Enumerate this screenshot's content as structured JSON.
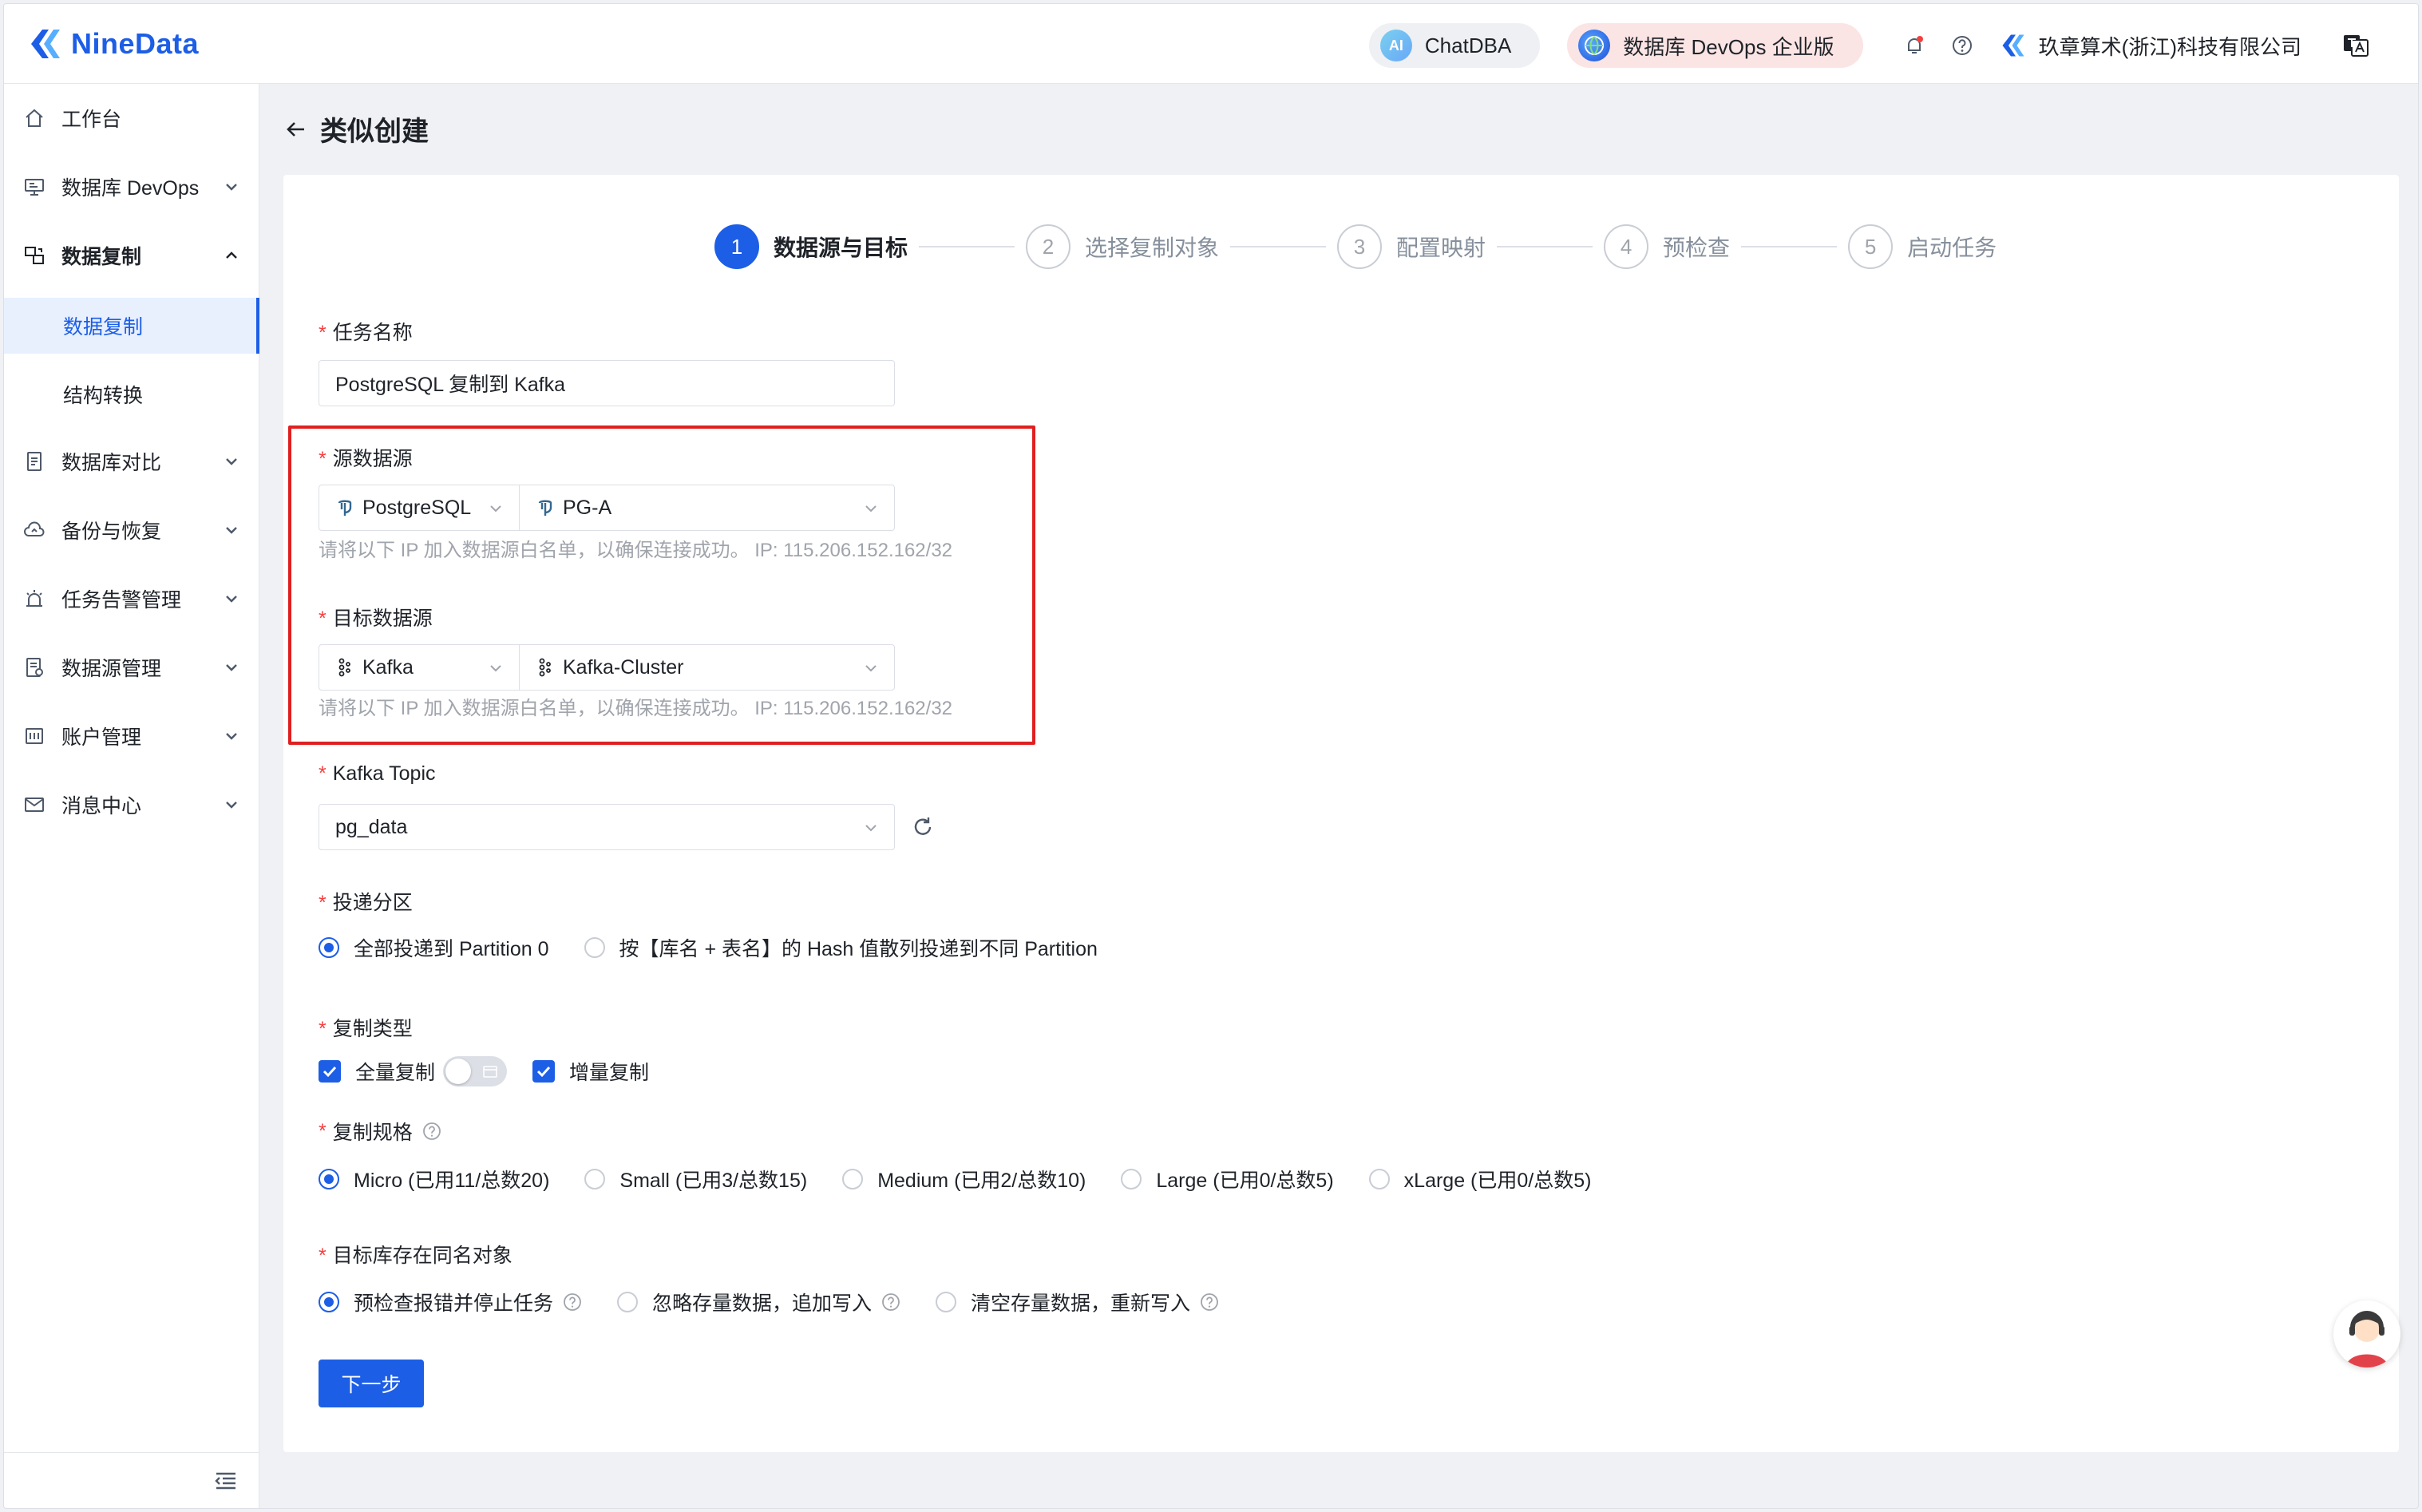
{
  "header": {
    "brand": "NineData",
    "chatdba": "ChatDBA",
    "chatdba_icon_text": "AI",
    "devops": "数据库 DevOps 企业版",
    "company": "玖章算术(浙江)科技有限公司"
  },
  "sidebar": {
    "items": [
      {
        "label": "工作台"
      },
      {
        "label": "数据库 DevOps"
      },
      {
        "label": "数据复制"
      },
      {
        "label": "数据复制"
      },
      {
        "label": "结构转换"
      },
      {
        "label": "数据库对比"
      },
      {
        "label": "备份与恢复"
      },
      {
        "label": "任务告警管理"
      },
      {
        "label": "数据源管理"
      },
      {
        "label": "账户管理"
      },
      {
        "label": "消息中心"
      }
    ]
  },
  "page": {
    "title": "类似创建"
  },
  "steps": [
    {
      "num": "1",
      "label": "数据源与目标"
    },
    {
      "num": "2",
      "label": "选择复制对象"
    },
    {
      "num": "3",
      "label": "配置映射"
    },
    {
      "num": "4",
      "label": "预检查"
    },
    {
      "num": "5",
      "label": "启动任务"
    }
  ],
  "form": {
    "required_mark": "*",
    "task_name_label": "任务名称",
    "task_name_value": "PostgreSQL 复制到 Kafka",
    "source_label": "源数据源",
    "source_type": "PostgreSQL",
    "source_instance": "PG-A",
    "source_hint": "请将以下 IP 加入数据源白名单，以确保连接成功。 IP: 115.206.152.162/32",
    "target_label": "目标数据源",
    "target_type": "Kafka",
    "target_instance": "Kafka-Cluster",
    "target_hint": "请将以下 IP 加入数据源白名单，以确保连接成功。 IP: 115.206.152.162/32",
    "topic_label": "Kafka Topic",
    "topic_value": "pg_data",
    "partition_label": "投递分区",
    "partition_opt1": "全部投递到 Partition 0",
    "partition_opt2": "按【库名 + 表名】的 Hash 值散列投递到不同 Partition",
    "copy_type_label": "复制类型",
    "copy_full": "全量复制",
    "copy_incr": "增量复制",
    "spec_label": "复制规格",
    "spec_opts": [
      "Micro (已用11/总数20)",
      "Small (已用3/总数15)",
      "Medium (已用2/总数10)",
      "Large (已用0/总数5)",
      "xLarge (已用0/总数5)"
    ],
    "same_obj_label": "目标库存在同名对象",
    "same_obj_opts": [
      "预检查报错并停止任务",
      "忽略存量数据，追加写入",
      "清空存量数据，重新写入"
    ],
    "next_button": "下一步"
  }
}
